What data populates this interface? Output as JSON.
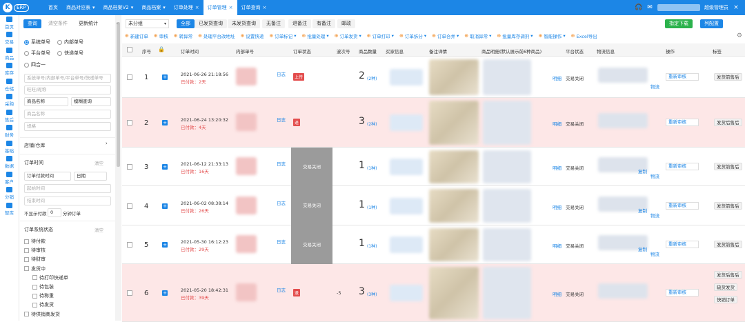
{
  "app": {
    "logo_letter": "K",
    "logo_text": "ERP"
  },
  "nav_tabs": [
    {
      "label": "首页",
      "closable": false,
      "active": false
    },
    {
      "label": "商品对应表",
      "closable": false,
      "dropdown": true,
      "active": false
    },
    {
      "label": "商品档案V2",
      "closable": false,
      "dropdown": true,
      "active": false
    },
    {
      "label": "商品档案",
      "closable": false,
      "dropdown": true,
      "active": false
    },
    {
      "label": "订单处理",
      "closable": true,
      "active": false
    },
    {
      "label": "订单管理",
      "closable": true,
      "active": true
    },
    {
      "label": "订单查询",
      "closable": true,
      "active": false
    }
  ],
  "top_right": {
    "user_role": "超级管理员",
    "close_glyph": "×"
  },
  "sidebar": [
    {
      "label": "首页",
      "icon": "home-icon"
    },
    {
      "label": "交易",
      "icon": "trade-icon"
    },
    {
      "label": "商品",
      "icon": "goods-icon"
    },
    {
      "label": "库存",
      "icon": "stock-icon"
    },
    {
      "label": "仓储",
      "icon": "warehouse-icon"
    },
    {
      "label": "采购",
      "icon": "purchase-icon"
    },
    {
      "label": "售后",
      "icon": "aftersale-icon"
    },
    {
      "label": "财务",
      "icon": "finance-icon"
    },
    {
      "label": "基础",
      "icon": "base-icon"
    },
    {
      "label": "数据",
      "icon": "data-icon"
    },
    {
      "label": "客户",
      "icon": "customer-icon"
    },
    {
      "label": "分销",
      "icon": "distribution-icon"
    },
    {
      "label": "智库",
      "icon": "library-icon"
    }
  ],
  "filter": {
    "query_btn": "查询",
    "clear_btn": "清空条件",
    "update_btn": "更新统计",
    "radios": [
      "系统单号",
      "内部单号",
      "平台单号",
      "快递单号",
      "四合一"
    ],
    "order_no_placeholder": "系统单号/内部单号/平台单号/快递单号",
    "wangwang_placeholder": "旺旺/昵称",
    "goods_name_select": "商品名称",
    "fuzzy_select": "模糊查询",
    "goods_name_placeholder": "商品名称",
    "spec_placeholder": "规格",
    "shop_section": "店铺/仓库",
    "order_time_section": "订单时间",
    "clear_link": "清空",
    "time_type": "订单付款时间",
    "time_unit": "日期",
    "start_placeholder": "起始时间",
    "end_placeholder": "结束时间",
    "not_show_prefix": "不显示付款",
    "not_show_value": "0",
    "not_show_suffix": "分钟订单",
    "status_section": "订单系统状态",
    "status_clear": "清空",
    "statuses": [
      {
        "label": "待付款",
        "indent": false
      },
      {
        "label": "待审核",
        "indent": false
      },
      {
        "label": "待财审",
        "indent": false
      },
      {
        "label": "发货中",
        "indent": false
      },
      {
        "label": "待打印快递单",
        "indent": true
      },
      {
        "label": "待包装",
        "indent": true
      },
      {
        "label": "待称重",
        "indent": true
      },
      {
        "label": "待发货",
        "indent": true
      },
      {
        "label": "待供销商发货",
        "indent": false
      }
    ]
  },
  "toolbar_top": {
    "group_select": "未分组",
    "pills": [
      "全部",
      "已发货查询",
      "未发货查询",
      "无备注",
      "退备注",
      "有备注",
      "邮政"
    ],
    "active_pill": "全部",
    "download_btn": "指定下载",
    "config_btn": "列配置"
  },
  "actions": [
    "新建订单",
    "审核",
    "转异常",
    "处理平台改地址",
    "设置快递",
    "订单标记",
    "批量处理",
    "订单发货",
    "订单打印",
    "订单拆分",
    "订单合并",
    "取消异常",
    "批量库存调剂",
    "智能操作",
    "Excel导出"
  ],
  "columns": [
    "序号",
    "订单时间",
    "内部单号",
    "订单状态",
    "波次号",
    "商品数量",
    "买家信息",
    "备注详情",
    "商品明细(默认展示前6种商品)",
    "平台状态",
    "物流信息",
    "操作",
    "标签"
  ],
  "rows": [
    {
      "seq": "1",
      "time": "2021-06-26 21:18:56",
      "paid": "已付款：2天",
      "status_tag": "上传",
      "status_grey": "",
      "wave": "",
      "qty": "2",
      "qty_kinds": "(2种)",
      "platform": "交易关闭",
      "detail_link": "明细",
      "logistics_link": "物流",
      "copy_link": "",
      "op": "重新审核",
      "tags": [
        "发货前售后"
      ],
      "pink": false,
      "h": 60
    },
    {
      "seq": "2",
      "time": "2021-06-24 13:20:32",
      "paid": "已付款：4天",
      "status_tag": "退",
      "status_grey": "",
      "wave": "",
      "qty": "3",
      "qty_kinds": "(2种)",
      "platform": "交易关闭",
      "detail_link": "明细",
      "logistics_link": "",
      "copy_link": "",
      "op": "重新审核",
      "tags": [
        "发货后售后"
      ],
      "pink": true,
      "h": 72
    },
    {
      "seq": "3",
      "time": "2021-06-12 21:33:13",
      "paid": "已付款：16天",
      "status_tag": "",
      "status_grey": "交易关闭",
      "wave": "",
      "qty": "1",
      "qty_kinds": "(1种)",
      "platform": "交易关闭",
      "detail_link": "明细",
      "logistics_link": "物流",
      "copy_link": "复制",
      "op": "重新审核",
      "tags": [
        "发货前售后"
      ],
      "pink": false,
      "h": 56
    },
    {
      "seq": "4",
      "time": "2021-06-02 08:38:14",
      "paid": "已付款：26天",
      "status_tag": "",
      "status_grey": "交易关闭",
      "wave": "",
      "qty": "1",
      "qty_kinds": "(1种)",
      "platform": "交易关闭",
      "detail_link": "明细",
      "logistics_link": "物流",
      "copy_link": "复制",
      "op": "重新审核",
      "tags": [
        "发货前售后"
      ],
      "pink": false,
      "h": 57
    },
    {
      "seq": "5",
      "time": "2021-05-30 16:12:23",
      "paid": "已付款：29天",
      "status_tag": "",
      "status_grey": "交易关闭",
      "wave": "",
      "qty": "1",
      "qty_kinds": "(1种)",
      "platform": "交易关闭",
      "detail_link": "明细",
      "logistics_link": "物流",
      "copy_link": "复制",
      "op": "重新审核",
      "tags": [
        "发货前售后"
      ],
      "pink": false,
      "h": 56
    },
    {
      "seq": "6",
      "time": "2021-05-20 18:42:31",
      "paid": "已付款：39天",
      "status_tag": "退",
      "status_grey": "",
      "wave": "-5",
      "qty": "3",
      "qty_kinds": "(3种)",
      "platform": "交易关闭",
      "detail_link": "明细",
      "logistics_link": "",
      "copy_link": "",
      "op": "重新审核",
      "tags": [
        "发货后售后",
        "缺货发货",
        "快销订单"
      ],
      "pink": true,
      "h": 84
    }
  ],
  "row_side_link": "日志",
  "colors": {
    "brand": "#1c86e6",
    "danger": "#e34d4d",
    "pink_row": "#fde7e7",
    "green": "#2bb24c"
  }
}
